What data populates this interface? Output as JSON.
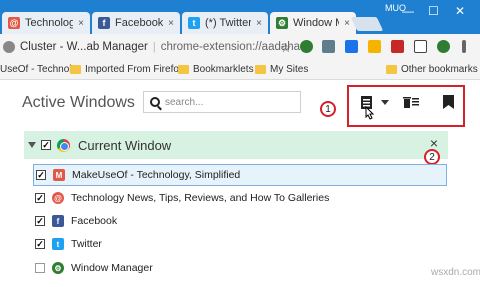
{
  "tabs": [
    {
      "title": "Technolog",
      "close": "×",
      "fav_color": "#e05a47",
      "fav_glyph": "@"
    },
    {
      "title": "Facebook",
      "close": "×",
      "fav_color": "#3b5998",
      "fav_glyph": "f"
    },
    {
      "title": "(*) Twitter",
      "close": "×",
      "fav_color": "#1da1f2",
      "fav_glyph": "t"
    },
    {
      "title": "Window M",
      "close": "×",
      "fav_color": "#2e7d32",
      "fav_glyph": "⚙"
    }
  ],
  "window": {
    "user": "MUO",
    "minimize": "—",
    "restore": "☐",
    "close": "✕"
  },
  "address": {
    "site": "Cluster - W...ab Manager",
    "url": "chrome-extension://aadaha...",
    "star": "☆"
  },
  "bookmarks": [
    "UseOf - Technol",
    "Imported From Firefo",
    "Bookmarklets",
    "My Sites",
    "Other bookmarks"
  ],
  "main": {
    "heading": "Active Windows",
    "search_placeholder": "search...",
    "callout1": "1",
    "callout2": "2",
    "group": {
      "title": "Current Window",
      "close": "×"
    },
    "rows": [
      {
        "label": "MakeUseOf - Technology, Simplified",
        "checked": "✓",
        "icon_color": "#e05a47",
        "icon_glyph": "M"
      },
      {
        "label": "Technology News, Tips, Reviews, and How To Galleries",
        "checked": "✓",
        "icon_color": "#e05a47",
        "icon_glyph": "@"
      },
      {
        "label": "Facebook",
        "checked": "✓",
        "icon_color": "#3b5998",
        "icon_glyph": "f"
      },
      {
        "label": "Twitter",
        "checked": "✓",
        "icon_color": "#1da1f2",
        "icon_glyph": "t"
      },
      {
        "label": "Window Manager",
        "checked": "",
        "icon_color": "#2e7d32",
        "icon_glyph": "⚙"
      }
    ]
  },
  "watermark": "wsxdn.com",
  "colors": {
    "accent": "#1f7fd0",
    "callout": "#d6202a",
    "group_bg": "#d7f2e3"
  }
}
